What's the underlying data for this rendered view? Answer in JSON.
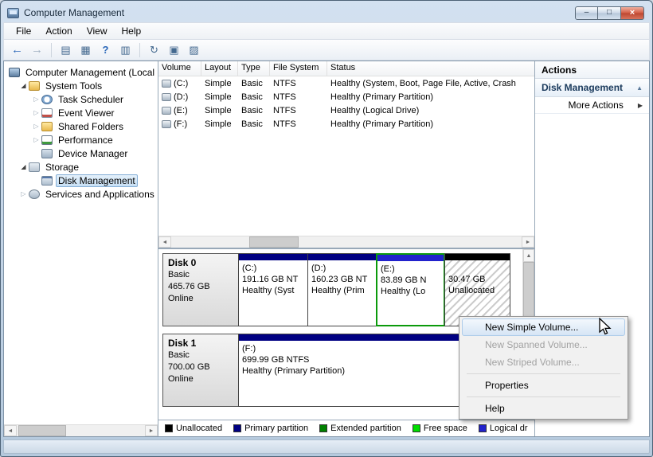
{
  "window": {
    "title": "Computer Management",
    "controls": {
      "min": "–",
      "max": "□",
      "close": "×"
    }
  },
  "menu": {
    "items": [
      "File",
      "Action",
      "View",
      "Help"
    ]
  },
  "toolbar": {
    "icons": [
      {
        "name": "back",
        "glyph": "←"
      },
      {
        "name": "forward",
        "glyph": "→"
      },
      {
        "name": "export-list",
        "glyph": "▤"
      },
      {
        "name": "console-window",
        "glyph": "▦"
      },
      {
        "name": "help",
        "glyph": "?"
      },
      {
        "name": "show-actions-pane",
        "glyph": "▥"
      },
      {
        "name": "refresh",
        "glyph": "↻"
      },
      {
        "name": "disk-view",
        "glyph": "▣"
      },
      {
        "name": "properties",
        "glyph": "▨"
      }
    ]
  },
  "glyphs": {
    "expanded": "◢",
    "collapsed": "▷",
    "chevron_up": "▲",
    "arrow_right": "▶",
    "scroll_left": "◄",
    "scroll_right": "►",
    "scroll_up": "▲",
    "scroll_down": "▼"
  },
  "tree": {
    "items": [
      {
        "label": "Computer Management (Local"
      },
      {
        "label": "System Tools",
        "expanded": true
      },
      {
        "label": "Task Scheduler",
        "collapsed": true
      },
      {
        "label": "Event Viewer",
        "collapsed": true
      },
      {
        "label": "Shared Folders",
        "collapsed": true
      },
      {
        "label": "Performance",
        "collapsed": true
      },
      {
        "label": "Device Manager"
      },
      {
        "label": "Storage",
        "expanded": true
      },
      {
        "label": "Disk Management",
        "selected": true
      },
      {
        "label": "Services and Applications",
        "collapsed": true
      }
    ]
  },
  "volume_list": {
    "columns": [
      "Volume",
      "Layout",
      "Type",
      "File System",
      "Status"
    ],
    "rows": [
      [
        "(C:)",
        "Simple",
        "Basic",
        "NTFS",
        "Healthy (System, Boot, Page File, Active, Crash"
      ],
      [
        "(D:)",
        "Simple",
        "Basic",
        "NTFS",
        "Healthy (Primary Partition)"
      ],
      [
        "(E:)",
        "Simple",
        "Basic",
        "NTFS",
        "Healthy (Logical Drive)"
      ],
      [
        "(F:)",
        "Simple",
        "Basic",
        "NTFS",
        "Healthy (Primary Partition)"
      ]
    ]
  },
  "disks": [
    {
      "name": "Disk 0",
      "type": "Basic",
      "size": "465.76 GB",
      "status": "Online",
      "partitions": [
        {
          "label": "(C:)",
          "size": "191.16 GB NT",
          "status": "Healthy (Syst",
          "color": "#000082"
        },
        {
          "label": "(D:)",
          "size": "160.23 GB NT",
          "status": "Healthy (Prim",
          "color": "#000082"
        },
        {
          "label": "(E:)",
          "size": "83.89 GB N",
          "status": "Healthy (Lo",
          "color": "#2222cc",
          "selected": true
        },
        {
          "size": "30.47 GB",
          "status": "Unallocated",
          "color": "#000000",
          "unallocated": true
        }
      ]
    },
    {
      "name": "Disk 1",
      "type": "Basic",
      "size": "700.00 GB",
      "status": "Online",
      "partitions": [
        {
          "label": "(F:)",
          "size": "699.99 GB NTFS",
          "status": "Healthy (Primary Partition)",
          "color": "#000082"
        }
      ]
    }
  ],
  "legend": [
    {
      "label": "Unallocated",
      "color": "#000000"
    },
    {
      "label": "Primary partition",
      "color": "#000082"
    },
    {
      "label": "Extended partition",
      "color": "#008000"
    },
    {
      "label": "Free space",
      "color": "#00dd00"
    },
    {
      "label": "Logical dr",
      "color": "#2222cc"
    }
  ],
  "context_menu": {
    "items": [
      {
        "label": "New Simple Volume...",
        "state": "highlighted"
      },
      {
        "label": "New Spanned Volume...",
        "state": "disabled"
      },
      {
        "label": "New Striped Volume...",
        "state": "disabled"
      },
      {
        "label": "Properties",
        "state": "normal"
      },
      {
        "label": "Help",
        "state": "normal"
      }
    ]
  },
  "actions": {
    "title": "Actions",
    "disk_management": "Disk Management",
    "more_actions": "More Actions"
  }
}
